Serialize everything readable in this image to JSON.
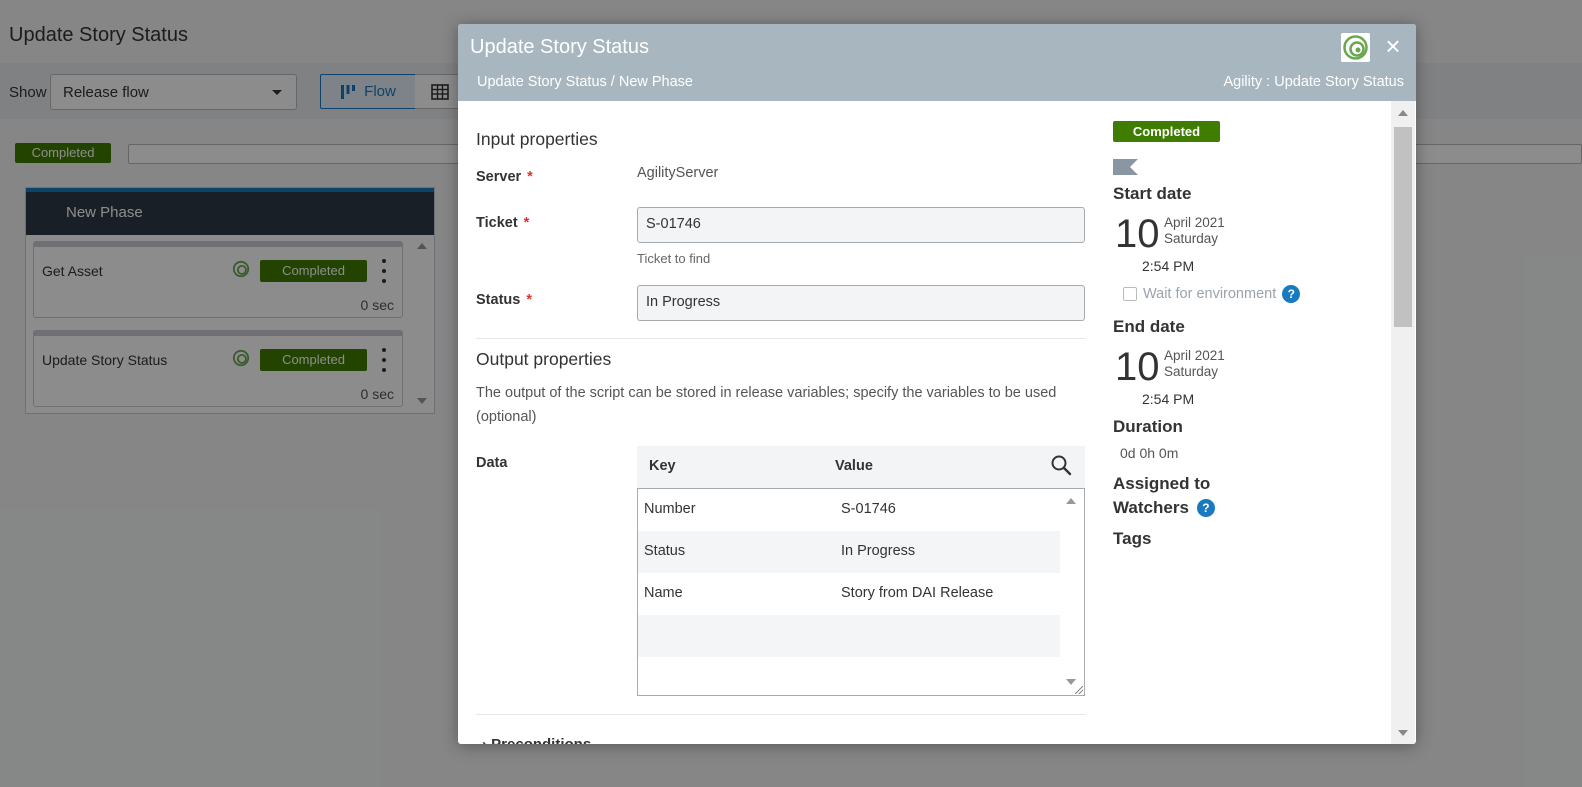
{
  "background": {
    "page_title": "Update Story Status",
    "show_label": "Show",
    "show_select_value": "Release flow",
    "flow_button_label": "Flow",
    "release_status": "Completed",
    "phase": {
      "title": "New Phase",
      "tasks": [
        {
          "name": "Get Asset",
          "status": "Completed",
          "duration": "0 sec"
        },
        {
          "name": "Update Story Status",
          "status": "Completed",
          "duration": "0 sec"
        }
      ]
    }
  },
  "modal": {
    "title": "Update Story Status",
    "breadcrumb": "Update Story Status / New Phase",
    "plugin": "Agility : Update Story Status",
    "close_icon": "×",
    "input_section_title": "Input properties",
    "server_label": "Server",
    "server_value": "AgilityServer",
    "ticket_label": "Ticket",
    "ticket_value": "S-01746",
    "ticket_hint": "Ticket to find",
    "status_label": "Status",
    "status_value": "In Progress",
    "required_mark": "*",
    "output_section_title": "Output properties",
    "output_description": "The output of the script can be stored in release variables; specify the variables to be used (optional)",
    "data_label": "Data",
    "table": {
      "key_header": "Key",
      "value_header": "Value",
      "rows": [
        {
          "key": "Number",
          "value": "S-01746"
        },
        {
          "key": "Status",
          "value": "In Progress"
        },
        {
          "key": "Name",
          "value": "Story from DAI Release"
        },
        {
          "key": "",
          "value": ""
        }
      ]
    },
    "preconditions_label": "Preconditions",
    "side": {
      "status_badge": "Completed",
      "start_date_label": "Start date",
      "start_day": "10",
      "start_month_year": "April 2021",
      "start_weekday": "Saturday",
      "start_time": "2:54 PM",
      "wait_for_env_label": "Wait for environment",
      "end_date_label": "End date",
      "end_day": "10",
      "end_month_year": "April 2021",
      "end_weekday": "Saturday",
      "end_time": "2:54 PM",
      "duration_label": "Duration",
      "duration_value": "0d 0h 0m",
      "assigned_label": "Assigned to",
      "watchers_label": "Watchers",
      "tags_label": "Tags",
      "help_glyph": "?"
    }
  },
  "colors": {
    "completed_green": "#3e7d00",
    "modal_header": "#a8b6c0",
    "accent_blue": "#1a7ac0",
    "required_red": "#d9342b"
  },
  "icons": {
    "close": "close-icon",
    "search": "search-icon",
    "help": "help-icon",
    "flag": "flag-icon",
    "agility_logo": "agility-logo-icon"
  }
}
